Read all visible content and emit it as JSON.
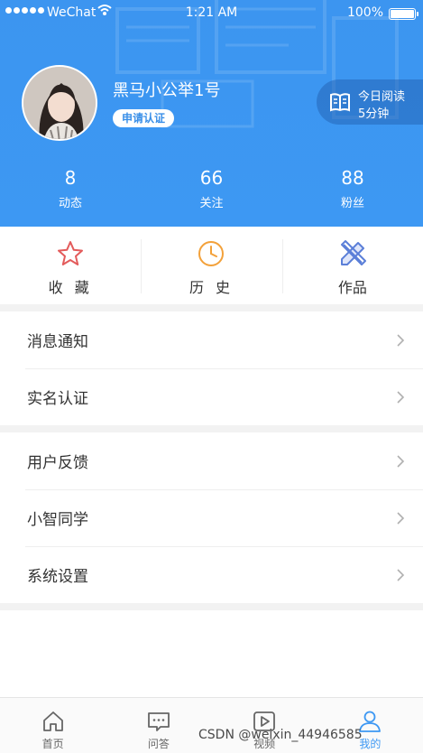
{
  "status_bar": {
    "carrier": "WeChat",
    "time": "1:21 AM",
    "battery_percent": "100%",
    "battery_level": 1.0
  },
  "profile": {
    "username": "黑马小公举1号",
    "verify_label": "申请认证",
    "reading": {
      "line1": "今日阅读",
      "line2": "5分钟"
    }
  },
  "stats": [
    {
      "value": "8",
      "label": "动态"
    },
    {
      "value": "66",
      "label": "关注"
    },
    {
      "value": "88",
      "label": "粉丝"
    }
  ],
  "shortcuts": [
    {
      "label": "收 藏",
      "icon": "star-icon"
    },
    {
      "label": "历 史",
      "icon": "clock-icon"
    },
    {
      "label": "作品",
      "icon": "pencil-ruler-icon"
    }
  ],
  "menu_group_1": [
    {
      "label": "消息通知"
    },
    {
      "label": "实名认证"
    }
  ],
  "menu_group_2": [
    {
      "label": "用户反馈"
    },
    {
      "label": "小智同学"
    },
    {
      "label": "系统设置"
    }
  ],
  "tabbar": [
    {
      "label": "首页",
      "icon": "home-icon"
    },
    {
      "label": "问答",
      "icon": "chat-icon"
    },
    {
      "label": "视频",
      "icon": "video-icon"
    },
    {
      "label": "我的",
      "icon": "user-icon",
      "active": true
    }
  ],
  "watermark": "CSDN @weixin_44946585",
  "colors": {
    "brand_blue": "#3d98f3",
    "star_red": "#e35b5b",
    "clock_orange": "#f3a13a",
    "pencil_blue": "#5b7fd8"
  }
}
